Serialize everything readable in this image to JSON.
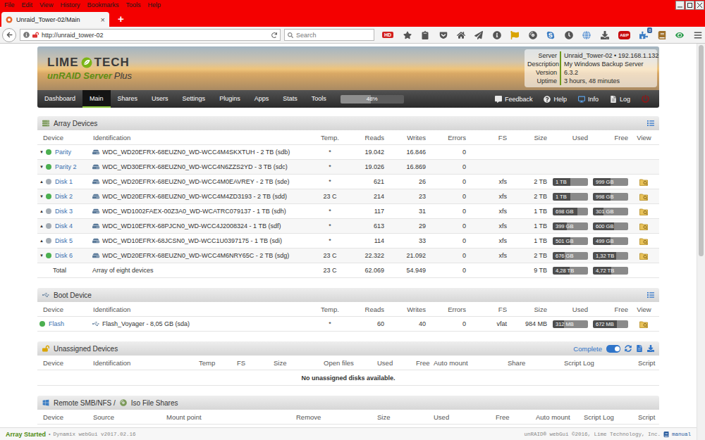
{
  "menu_bar": {
    "items": [
      "File",
      "Edit",
      "View",
      "History",
      "Bookmarks",
      "Tools",
      "Help"
    ]
  },
  "tabs": [
    {
      "label": "Unraid_Tower-02/Main",
      "selected": true,
      "close": "×"
    }
  ],
  "new_tab": "+",
  "address_bar": {
    "url": "http://unraid_tower-02",
    "search_placeholder": "Search"
  },
  "toolbar": {
    "hd_badge": "HD",
    "abp_badge": "ABP",
    "addon_count": "0"
  },
  "header": {
    "logo_left": "LIME",
    "logo_right": "TECH",
    "product": "unRAID Server",
    "edition": "Plus",
    "info": [
      {
        "label": "Server",
        "value": "Unraid_Tower-02 • 192.168.1.132"
      },
      {
        "label": "Description",
        "value": "My Windows Backup Server"
      },
      {
        "label": "Version",
        "value": "6.3.2"
      },
      {
        "label": "Uptime",
        "value": "3 hours, 48 minutes"
      }
    ]
  },
  "nav": {
    "items": [
      {
        "label": "Dashboard",
        "selected": false
      },
      {
        "label": "Main",
        "selected": true
      },
      {
        "label": "Shares",
        "selected": false
      },
      {
        "label": "Users",
        "selected": false
      },
      {
        "label": "Settings",
        "selected": false
      },
      {
        "label": "Plugins",
        "selected": false
      },
      {
        "label": "Apps",
        "selected": false
      },
      {
        "label": "Stats",
        "selected": false
      },
      {
        "label": "Tools",
        "selected": false
      }
    ],
    "progress": {
      "label": "48%",
      "level": 0.48
    },
    "links": [
      "Feedback",
      "Help",
      "Info",
      "Log"
    ]
  },
  "array_devices": {
    "title": "Array Devices",
    "columns": [
      "Device",
      "Identification",
      "Temp.",
      "Reads",
      "Writes",
      "Errors",
      "FS",
      "Size",
      "Used",
      "Free",
      "View"
    ],
    "rows": [
      {
        "kind": "parity",
        "device": "Parity",
        "arrow": "▼",
        "color": "#4caf50",
        "identification": "WDC_WD20EFRX-68EUZN0_WD-WCC4M4SKXTUH - 2 TB (sdb)",
        "temp": "*",
        "reads": "19.042",
        "writes": "16.846",
        "errors": "0"
      },
      {
        "kind": "parity",
        "device": "Parity 2",
        "arrow": "▼",
        "color": "#4caf50",
        "identification": "WDC_WD30EFRX-68EUZN0_WD-WCC4N6ZZS2YD - 3 TB (sdc)",
        "temp": "*",
        "reads": "19.026",
        "writes": "16.869",
        "errors": "0"
      },
      {
        "kind": "disk",
        "device": "Disk 1",
        "arrow": "▲",
        "color": "#a3abb3",
        "identification": "WDC_WD20EFRX-68EUZN0_WD-WCC4M0EAVREY - 2 TB (sde)",
        "temp": "*",
        "reads": "621",
        "writes": "26",
        "errors": "0",
        "fs": "xfs",
        "size": "2 TB",
        "used": "1 TB",
        "used_level": 0.5,
        "free": "999 GB",
        "free_level": 0.5,
        "browse": true
      },
      {
        "kind": "disk",
        "device": "Disk 2",
        "arrow": "▼",
        "color": "#4caf50",
        "identification": "WDC_WD20EFRX-68EUZN0_WD-WCC4M4ZD3193 - 2 TB (sdd)",
        "temp": "23 C",
        "reads": "214",
        "writes": "23",
        "errors": "0",
        "fs": "xfs",
        "size": "2 TB",
        "used": "1 TB",
        "used_level": 0.5,
        "free": "998 GB",
        "free_level": 0.5,
        "browse": true
      },
      {
        "kind": "disk",
        "device": "Disk 3",
        "arrow": "▲",
        "color": "#a3abb3",
        "identification": "WDC_WD1002FAEX-00Z3A0_WD-WCATRC079137 - 1 TB (sdh)",
        "temp": "*",
        "reads": "117",
        "writes": "31",
        "errors": "0",
        "fs": "xfs",
        "size": "1 TB",
        "used": "698 GB",
        "used_level": 0.7,
        "free": "301 GB",
        "free_level": 0.3,
        "browse": true
      },
      {
        "kind": "disk",
        "device": "Disk 4",
        "arrow": "▲",
        "color": "#a3abb3",
        "identification": "WDC_WD10EFRX-68PJCN0_WD-WCC4J2008324 - 1 TB (sdf)",
        "temp": "*",
        "reads": "613",
        "writes": "29",
        "errors": "0",
        "fs": "xfs",
        "size": "1 TB",
        "used": "399 GB",
        "used_level": 0.4,
        "free": "600 GB",
        "free_level": 0.6,
        "browse": true
      },
      {
        "kind": "disk",
        "device": "Disk 5",
        "arrow": "▲",
        "color": "#a3abb3",
        "identification": "WDC_WD10EFRX-68JCSN0_WD-WCC1U0397175 - 1 TB (sdi)",
        "temp": "*",
        "reads": "114",
        "writes": "33",
        "errors": "0",
        "fs": "xfs",
        "size": "1 TB",
        "used": "501 GB",
        "used_level": 0.5,
        "free": "499 GB",
        "free_level": 0.5,
        "browse": true
      },
      {
        "kind": "disk",
        "device": "Disk 6",
        "arrow": "▼",
        "color": "#4caf50",
        "identification": "WDC_WD20EFRX-68EUZN0_WD-WCC4M6NRY65C - 2 TB (sdg)",
        "temp": "23 C",
        "reads": "22.322",
        "writes": "21.092",
        "errors": "0",
        "fs": "xfs",
        "size": "2 TB",
        "used": "676 GB",
        "used_level": 0.34,
        "free": "1,32 TB",
        "free_level": 0.66,
        "browse": true
      },
      {
        "kind": "total",
        "device": "Total",
        "identification": "Array of eight devices",
        "temp": "23 C",
        "reads": "62.069",
        "writes": "54.949",
        "errors": "0",
        "size": "9 TB",
        "used": "4,28 TB",
        "used_level": 0.48,
        "free": "4,72 TB",
        "free_level": 0.52,
        "browse": false
      }
    ]
  },
  "boot_device": {
    "title": "Boot Device",
    "columns": [
      "Device",
      "Identification",
      "Temp.",
      "Reads",
      "Writes",
      "Errors",
      "FS",
      "Size",
      "Used",
      "Free",
      "View"
    ],
    "rows": [
      {
        "kind": "boot",
        "device": "Flash",
        "color": "#4caf50",
        "identification": "Flash_Voyager - 8,05 GB (sda)",
        "temp": "*",
        "reads": "60",
        "writes": "40",
        "errors": "0",
        "fs": "vfat",
        "size": "984 MB",
        "used": "312 MB",
        "used_level": 0.32,
        "free": "672 MB",
        "free_level": 0.68,
        "browse": true
      }
    ]
  },
  "unassigned_devices": {
    "title": "Unassigned Devices",
    "mode": "Complete",
    "mode_on": true,
    "columns": [
      "Device",
      "Identification",
      "Temp",
      "FS",
      "Size",
      "Open files",
      "Used",
      "Free",
      "Auto mount",
      "Share",
      "Script Log",
      "Script"
    ],
    "message": "No unassigned disks available."
  },
  "remote_shares": {
    "title_parts": [
      "Remote SMB/NFS /",
      "Iso File Shares"
    ],
    "columns": [
      "Device",
      "Source",
      "Mount point",
      "Remove",
      "Size",
      "Used",
      "Free",
      "Auto mount",
      "Script Log",
      "Script"
    ]
  },
  "status_bar": {
    "state": "Array Started",
    "separator": "•",
    "version": "Dynamix webGui v2017.02.16",
    "copyright": "unRAID® webGui ©2016, Lime Technology, Inc.",
    "manual": "manual"
  }
}
